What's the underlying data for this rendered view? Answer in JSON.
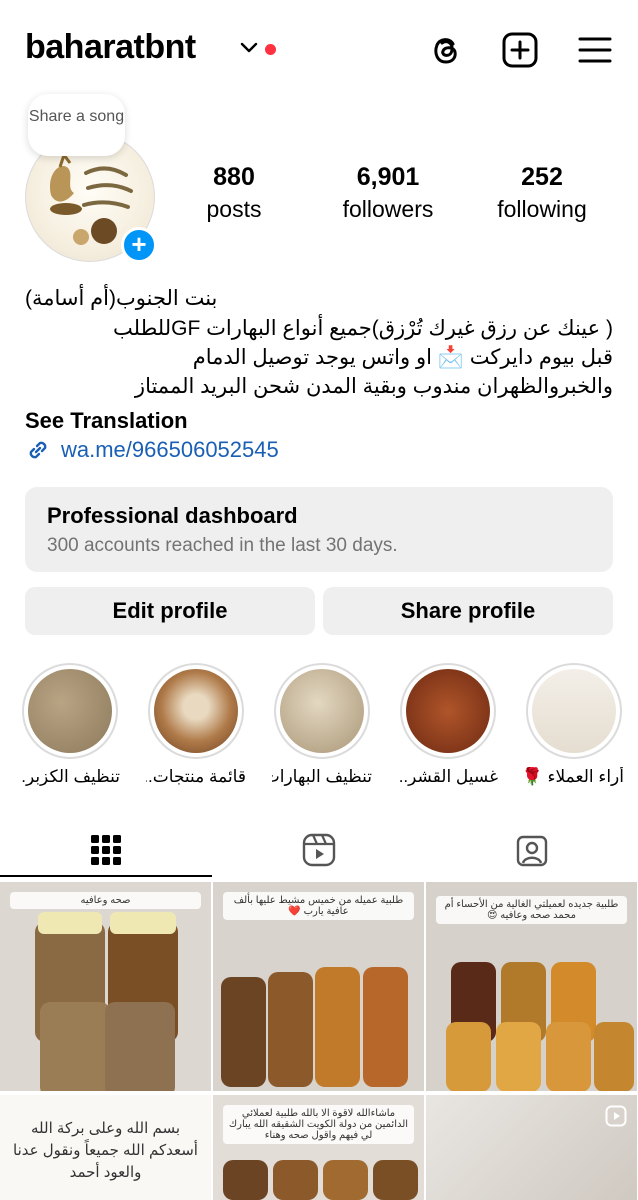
{
  "header": {
    "username": "baharatbnt"
  },
  "profile": {
    "song_bubble": "Share a song",
    "stats": [
      {
        "number": "880",
        "label": "posts"
      },
      {
        "number": "6,901",
        "label": "followers"
      },
      {
        "number": "252",
        "label": "following"
      }
    ],
    "bio_name": "بنت الجنوب(أم أسامة)",
    "bio_lines": [
      "( عينك عن رزق غيرك تُرْزق)جميع أنواع البهارات GFللطلب",
      "قبل بيوم دايركت 📩 او واتس يوجد توصيل الدمام",
      "والخبروالظهران مندوب وبقية المدن شحن البريد الممتاز"
    ],
    "see_translation": "See Translation",
    "link": "wa.me/966506052545"
  },
  "dashboard": {
    "title": "Professional dashboard",
    "subtitle": "300 accounts reached in the last 30 days."
  },
  "buttons": {
    "edit": "Edit profile",
    "share": "Share profile"
  },
  "highlights": [
    {
      "label": "تنظيف الكزبر...",
      "color": "#a89372"
    },
    {
      "label": "قائمة منتجات...",
      "color": "#b07b4a"
    },
    {
      "label": "تنظيف البهارات",
      "color": "#c7b79a"
    },
    {
      "label": "غسيل القشر...",
      "color": "#8a3a1e"
    },
    {
      "label": "أراء العملاء 🌹",
      "color": "#efe9df"
    }
  ],
  "grid_captions": [
    "صحه وعافيه",
    "طلبية عميله من خميس مشيط عليها بألف عافية يارب ❤️",
    "طلبية جديده لعميلتي الغالية من الأحساء أم محمد صحه وعافيه 😍",
    "بسم الله وعلى بركة الله أسعدكم الله جميعاً ونقول عدنا والعود أحمد",
    "ماشاءالله لاقوة الا بالله طلبية لعملائي الدائمين من دولة الكويت الشقيقه الله يبارك لي فيهم واقول صحه وهناء"
  ],
  "colors": {
    "accent": "#0095f6",
    "notification": "#ff3040",
    "link": "#1a5fb4"
  }
}
